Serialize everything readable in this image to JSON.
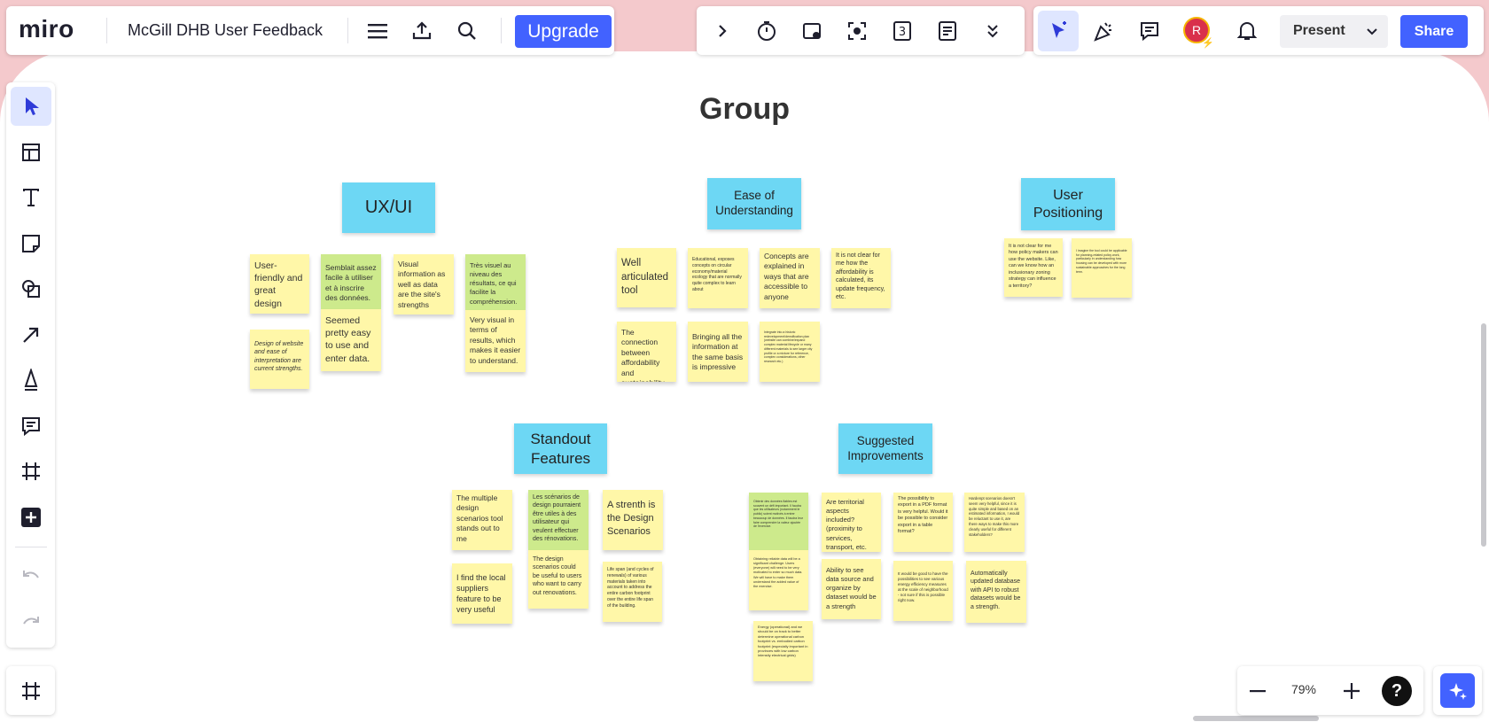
{
  "app": {
    "logo": "miro",
    "board_title": "McGill DHB User Feedback",
    "upgrade_label": "Upgrade",
    "present_label": "Present",
    "share_label": "Share",
    "avatar_initial": "R",
    "zoom_level": "79%",
    "help_label": "?",
    "accent_color": "#4262ff"
  },
  "board": {
    "heading": "Group",
    "groups": {
      "uxui": {
        "label": "UX/UI",
        "notes": [
          "User-friendly and great design",
          "Design of website and ease of interpretation are current strengths.",
          "Semblait assez facile à utiliser et à inscrire des données.",
          "Seemed pretty easy to use and enter data.",
          "Visual information as well as data are the site's strengths",
          "Très visuel au niveau des résultats, ce qui facilite la compréhension.",
          "Very visual in terms of results, which makes it easier to understand."
        ]
      },
      "ease": {
        "label": "Ease of Understanding",
        "notes": [
          "Well articulated tool",
          "Educational, exposes concepts on circular economy/material ecology that are normally quite complex to learn about",
          "Concepts are explained in ways that are accessible to anyone",
          "It is not clear for me how the affordability is calculated, its update frequency, etc.",
          "The connection between affordability and sustainability is clear",
          "Bringing all the information at the same basis is impressive",
          "Integrate into a historic redevelopment/densification plan (website can combine/expand complex material lifecycle or many different materials to see larger city profile or a mixture for reference, complex considerations, other research etc.)"
        ]
      },
      "user_positioning": {
        "label": "User Positioning",
        "notes": [
          "It is not clear for me how policy makers can use the website. Like, can we know how an inclusionary zoning strategy can influence a territory?",
          "I imagine the tool could be applicable for planning-related policy work, particularly in understanding how housing can be developed with more sustainable approaches for the long term."
        ]
      },
      "standout": {
        "label": "Standout Features",
        "notes": [
          "The multiple design scenarios tool stands out to me",
          "I find the local suppliers feature to be very useful",
          "Les scénarios de design pourraient être utiles à des utilisateur qui veulent effectuer des rénovations.",
          "The design scenarios could be useful to users who want to carry out renovations.",
          "A strenth is the Design Scenarios",
          "Life span (and cycles of renewals) of various materials taken into account to address the entire carbon footprint over the entire life span of the building."
        ]
      },
      "suggested": {
        "label": "Suggested Improvements",
        "notes": [
          "Obtenir des données fiables est souvent un défi important. Il faudra que les utilisateurs (notamment le public) soient motivés à entrer beaucoup de données. Il faudra leur faire comprendre la valeur ajoutée de l'exercice.",
          "Obtaining reliable data will be a significant challenge. Users (everyone) will need to be very motivated to enter so much data. We will have to make them understand the added value of the exercise.",
          "Energy (operational) and we should be on track to better determine operational carbon footprint vs. embodied carbon footprint (especially important in provinces with low carbon intensity electrical grids)",
          "Are territorial aspects included? (proximity to services, transport, etc.",
          "Ability to see data source and organize by dataset would be a strength",
          "The possibility to export in a PDF format is very helpful. Would it be possible to consider export in a table format?",
          "It would be good to have the possibilities to see various energy efficiency measures at the scale of neighborhood - not sure if this is possible right now.",
          "Hardenpt scenarios doesn't seem very helpful, since it is quite simple and based on an estimated information, I would be reluctant to use it, are there ways to make this more clearly useful for different stakeholders?",
          "Automatically updated database with API to robust datasets would be a strength."
        ]
      }
    }
  }
}
